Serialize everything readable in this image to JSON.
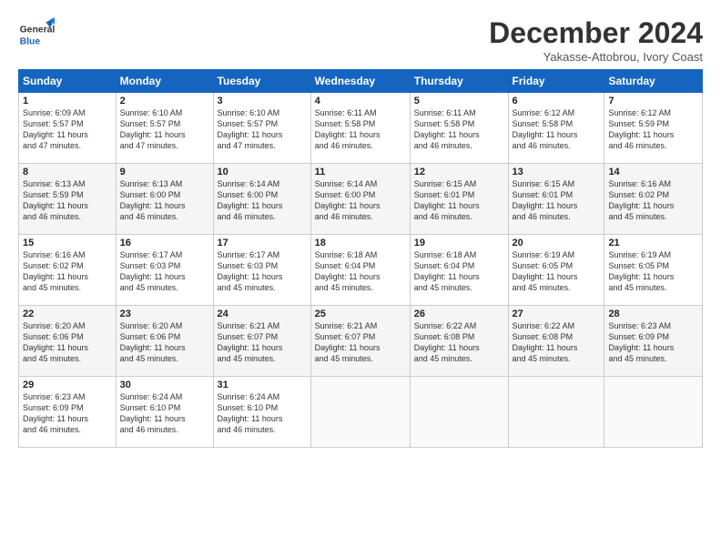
{
  "header": {
    "month": "December 2024",
    "location": "Yakasse-Attobrou, Ivory Coast",
    "logo_general": "General",
    "logo_blue": "Blue"
  },
  "days_of_week": [
    "Sunday",
    "Monday",
    "Tuesday",
    "Wednesday",
    "Thursday",
    "Friday",
    "Saturday"
  ],
  "weeks": [
    [
      {
        "day": "1",
        "info": "Sunrise: 6:09 AM\nSunset: 5:57 PM\nDaylight: 11 hours\nand 47 minutes."
      },
      {
        "day": "2",
        "info": "Sunrise: 6:10 AM\nSunset: 5:57 PM\nDaylight: 11 hours\nand 47 minutes."
      },
      {
        "day": "3",
        "info": "Sunrise: 6:10 AM\nSunset: 5:57 PM\nDaylight: 11 hours\nand 47 minutes."
      },
      {
        "day": "4",
        "info": "Sunrise: 6:11 AM\nSunset: 5:58 PM\nDaylight: 11 hours\nand 46 minutes."
      },
      {
        "day": "5",
        "info": "Sunrise: 6:11 AM\nSunset: 5:58 PM\nDaylight: 11 hours\nand 46 minutes."
      },
      {
        "day": "6",
        "info": "Sunrise: 6:12 AM\nSunset: 5:58 PM\nDaylight: 11 hours\nand 46 minutes."
      },
      {
        "day": "7",
        "info": "Sunrise: 6:12 AM\nSunset: 5:59 PM\nDaylight: 11 hours\nand 46 minutes."
      }
    ],
    [
      {
        "day": "8",
        "info": "Sunrise: 6:13 AM\nSunset: 5:59 PM\nDaylight: 11 hours\nand 46 minutes."
      },
      {
        "day": "9",
        "info": "Sunrise: 6:13 AM\nSunset: 6:00 PM\nDaylight: 11 hours\nand 46 minutes."
      },
      {
        "day": "10",
        "info": "Sunrise: 6:14 AM\nSunset: 6:00 PM\nDaylight: 11 hours\nand 46 minutes."
      },
      {
        "day": "11",
        "info": "Sunrise: 6:14 AM\nSunset: 6:00 PM\nDaylight: 11 hours\nand 46 minutes."
      },
      {
        "day": "12",
        "info": "Sunrise: 6:15 AM\nSunset: 6:01 PM\nDaylight: 11 hours\nand 46 minutes."
      },
      {
        "day": "13",
        "info": "Sunrise: 6:15 AM\nSunset: 6:01 PM\nDaylight: 11 hours\nand 46 minutes."
      },
      {
        "day": "14",
        "info": "Sunrise: 6:16 AM\nSunset: 6:02 PM\nDaylight: 11 hours\nand 45 minutes."
      }
    ],
    [
      {
        "day": "15",
        "info": "Sunrise: 6:16 AM\nSunset: 6:02 PM\nDaylight: 11 hours\nand 45 minutes."
      },
      {
        "day": "16",
        "info": "Sunrise: 6:17 AM\nSunset: 6:03 PM\nDaylight: 11 hours\nand 45 minutes."
      },
      {
        "day": "17",
        "info": "Sunrise: 6:17 AM\nSunset: 6:03 PM\nDaylight: 11 hours\nand 45 minutes."
      },
      {
        "day": "18",
        "info": "Sunrise: 6:18 AM\nSunset: 6:04 PM\nDaylight: 11 hours\nand 45 minutes."
      },
      {
        "day": "19",
        "info": "Sunrise: 6:18 AM\nSunset: 6:04 PM\nDaylight: 11 hours\nand 45 minutes."
      },
      {
        "day": "20",
        "info": "Sunrise: 6:19 AM\nSunset: 6:05 PM\nDaylight: 11 hours\nand 45 minutes."
      },
      {
        "day": "21",
        "info": "Sunrise: 6:19 AM\nSunset: 6:05 PM\nDaylight: 11 hours\nand 45 minutes."
      }
    ],
    [
      {
        "day": "22",
        "info": "Sunrise: 6:20 AM\nSunset: 6:06 PM\nDaylight: 11 hours\nand 45 minutes."
      },
      {
        "day": "23",
        "info": "Sunrise: 6:20 AM\nSunset: 6:06 PM\nDaylight: 11 hours\nand 45 minutes."
      },
      {
        "day": "24",
        "info": "Sunrise: 6:21 AM\nSunset: 6:07 PM\nDaylight: 11 hours\nand 45 minutes."
      },
      {
        "day": "25",
        "info": "Sunrise: 6:21 AM\nSunset: 6:07 PM\nDaylight: 11 hours\nand 45 minutes."
      },
      {
        "day": "26",
        "info": "Sunrise: 6:22 AM\nSunset: 6:08 PM\nDaylight: 11 hours\nand 45 minutes."
      },
      {
        "day": "27",
        "info": "Sunrise: 6:22 AM\nSunset: 6:08 PM\nDaylight: 11 hours\nand 45 minutes."
      },
      {
        "day": "28",
        "info": "Sunrise: 6:23 AM\nSunset: 6:09 PM\nDaylight: 11 hours\nand 45 minutes."
      }
    ],
    [
      {
        "day": "29",
        "info": "Sunrise: 6:23 AM\nSunset: 6:09 PM\nDaylight: 11 hours\nand 46 minutes."
      },
      {
        "day": "30",
        "info": "Sunrise: 6:24 AM\nSunset: 6:10 PM\nDaylight: 11 hours\nand 46 minutes."
      },
      {
        "day": "31",
        "info": "Sunrise: 6:24 AM\nSunset: 6:10 PM\nDaylight: 11 hours\nand 46 minutes."
      },
      {
        "day": "",
        "info": ""
      },
      {
        "day": "",
        "info": ""
      },
      {
        "day": "",
        "info": ""
      },
      {
        "day": "",
        "info": ""
      }
    ]
  ]
}
